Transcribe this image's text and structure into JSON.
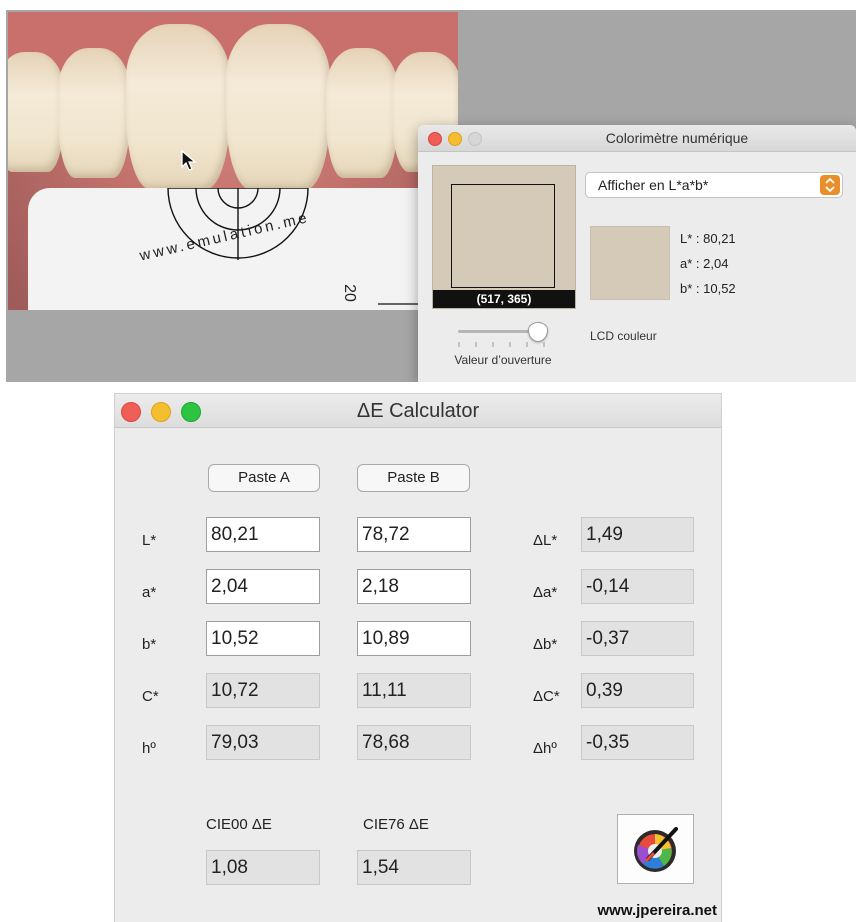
{
  "colorimeter": {
    "title": "Colorimètre numérique",
    "coords": "(517, 365)",
    "aperture_label": "Valeur d’ouverture",
    "display_mode": "Afficher en L*a*b*",
    "lab": {
      "l": "L* :  80,21",
      "a": "a* :  2,04",
      "b": "b* :  10,52"
    },
    "lcd_label": "LCD couleur",
    "sample_color": "#d4cab7"
  },
  "photo": {
    "card_text": "www.emulation.me",
    "card_number": "20"
  },
  "calculator": {
    "title": "ΔE Calculator",
    "paste_a": "Paste A",
    "paste_b": "Paste B",
    "rows": [
      {
        "label": "L*",
        "a": "80,21",
        "b": "78,72",
        "dlabel": "ΔL*",
        "delta": "1,49"
      },
      {
        "label": "a*",
        "a": "2,04",
        "b": "2,18",
        "dlabel": "Δa*",
        "delta": "-0,14"
      },
      {
        "label": "b*",
        "a": "10,52",
        "b": "10,89",
        "dlabel": "Δb*",
        "delta": "-0,37"
      },
      {
        "label": "C*",
        "a": "10,72",
        "b": "11,11",
        "dlabel": "ΔC*",
        "delta": "0,39"
      },
      {
        "label": "hº",
        "a": "79,03",
        "b": "78,68",
        "dlabel": "Δhº",
        "delta": "-0,35"
      }
    ],
    "cie00_label": "CIE00 ΔE",
    "cie00_value": "1,08",
    "cie76_label": "CIE76 ΔE",
    "cie76_value": "1,54",
    "color_picker_icon": "color-wheel-icon",
    "footer_url": "www.jpereira.net"
  }
}
